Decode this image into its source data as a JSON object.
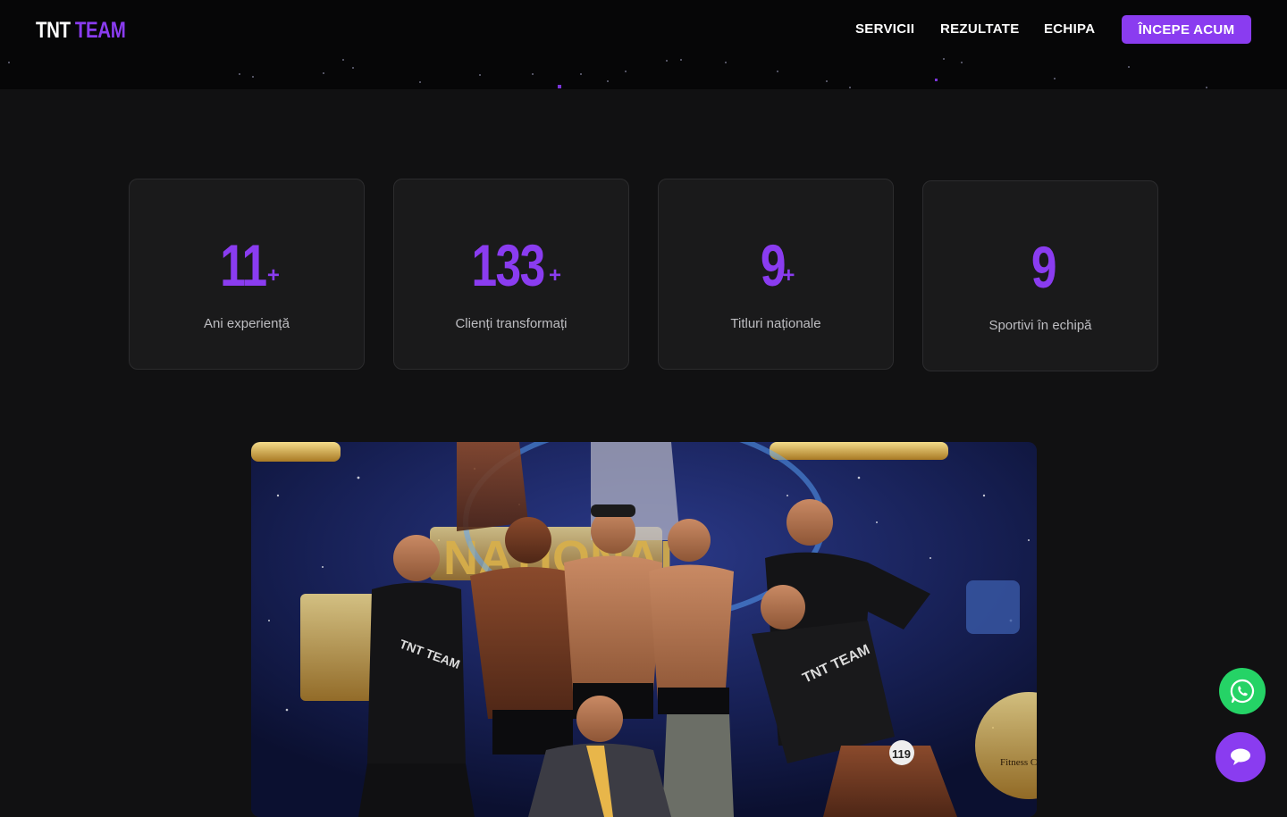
{
  "header": {
    "logo_word1": "TNT",
    "logo_word2": "TEAM",
    "nav": [
      "SERVICII",
      "REZULTATE",
      "ECHIPA"
    ],
    "cta_label": "ÎNCEPE ACUM"
  },
  "stats": [
    {
      "value": "11",
      "suffix": "+",
      "label": "Ani experiență"
    },
    {
      "value": "133",
      "suffix": "+",
      "label": "Clienți transformați"
    },
    {
      "value": "9",
      "suffix": "+",
      "label": "Titluri naționale"
    },
    {
      "value": "9",
      "suffix": "",
      "label": "Sportivi în echipă"
    }
  ],
  "photo": {
    "shirt_print": "TNT TEAM",
    "banner_text": "NATIONAL",
    "bib_number": "119",
    "badge_text": "Fitness COLI"
  },
  "colors": {
    "accent": "#8a3cf0",
    "whatsapp": "#25d366",
    "background": "#111112"
  },
  "icons": {
    "whatsapp": "whatsapp-icon",
    "chat": "chat-bubble-icon"
  }
}
